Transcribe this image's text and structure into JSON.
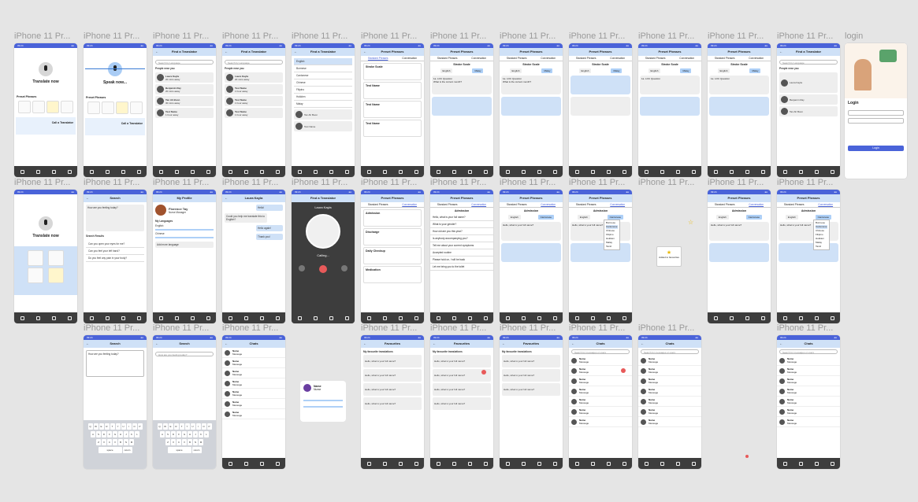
{
  "frame_label": "iPhone 11 Pr...",
  "login_label": "login",
  "statusbar": {
    "time": "09:24"
  },
  "home": {
    "title": "Translate now",
    "preset_heading": "Preset Phrases",
    "call_translator": "Call a Translator",
    "tiles": [
      "Medical Emer.",
      "Daily Conversations",
      "Find a Translator",
      "Favourites"
    ]
  },
  "speaking": {
    "title": "Speak now...",
    "preset_heading": "Preset Phrases"
  },
  "find_translator": {
    "title": "Find a Translator",
    "search_placeholder": "Search by Language",
    "people_near": "People near you",
    "people": [
      {
        "name": "Laura Kayla",
        "sub": "20 mins away"
      },
      {
        "name": "Benjamin Ray",
        "sub": "20 mins away"
      },
      {
        "name": "Tan Ah Boon",
        "sub": "30 mins away"
      },
      {
        "name": "Test Name",
        "sub": "1 hour away"
      }
    ]
  },
  "languages": [
    "English",
    "Burmese",
    "Cantonese",
    "Chinese",
    "Filipino",
    "Hokkien",
    "Malay"
  ],
  "preset_phrases": {
    "title": "Preset Phrases",
    "tab_standard": "Standard Phrases",
    "tab_conversation": "Conversation",
    "cards": [
      "Stroke Scale",
      "Test Name",
      "Test Name",
      "Test Name"
    ],
    "categories": [
      "Admission",
      "Discharge",
      "Daily Checkup",
      "Medication"
    ]
  },
  "stroke": {
    "title": "Stroke Scale",
    "lang_a": "English",
    "lang_b": "Malay",
    "q1": "1a. LOC Question",
    "q1_text": "What is the current month?"
  },
  "admission": {
    "title": "Admission",
    "lang_a": "English",
    "lang_b": "Cantonese",
    "items": [
      "Hello, what is your full name?",
      "What is your gender?",
      "How old are you this year?",
      "Is anybody accompanying you?",
      "Tell me about your current symptoms",
      "Accepted routine",
      "Please hold on, I will be back",
      "Let me bring you to the toilet"
    ],
    "dropdown": [
      "Burmese",
      "Cantonese",
      "Chinese",
      "Filipino",
      "Hokkien",
      "Malay",
      "Tamil"
    ],
    "reply": "Hello, what is your full name?"
  },
  "search": {
    "title": "Search",
    "placeholder": "How are you feeling today?",
    "results_heading": "Search Results",
    "results": [
      "Can you open your eyes for me?",
      "Can you feel your left hand?",
      "Do you feel any pain in your body?"
    ]
  },
  "profile": {
    "title": "My Profile",
    "name": "Florence Tay",
    "role": "Nurse Manager",
    "languages_heading": "My Languages",
    "langs": [
      "English",
      "Chinese"
    ],
    "add_label": "Add more language"
  },
  "chat": {
    "contact": "Laura Kayla",
    "msg1": "Hello!",
    "msg2": "Could you help me translate this to English?",
    "msg3": "Hello again!",
    "msg4": "Thank you!"
  },
  "calling": {
    "title": "Find a Translator",
    "name": "Laura Kayla",
    "status": "Calling..."
  },
  "favourites": {
    "title": "Favourites",
    "heading": "My favourite translations",
    "items": [
      "Hello, what is your full name?",
      "Hello, what is your full name?",
      "Hello, what is your full name?",
      "Hello, what is your full name?"
    ]
  },
  "chats": {
    "title": "Chats",
    "search_placeholder": "Search for messages or users",
    "rows": [
      "Name",
      "Name",
      "Name",
      "Name",
      "Name",
      "Name",
      "Name"
    ],
    "row_sub": "Message"
  },
  "keyboard": {
    "rows": [
      "QWERTYUIOP",
      "ASDFGHJKL",
      "ZXCVBNM"
    ],
    "space": "space",
    "ret": "return"
  },
  "login": {
    "title": "Login",
    "button": "Login"
  },
  "mini_card": {
    "name": "Name",
    "sub": "Nurse"
  },
  "fav_mini": {
    "label": "Added to favourites"
  }
}
